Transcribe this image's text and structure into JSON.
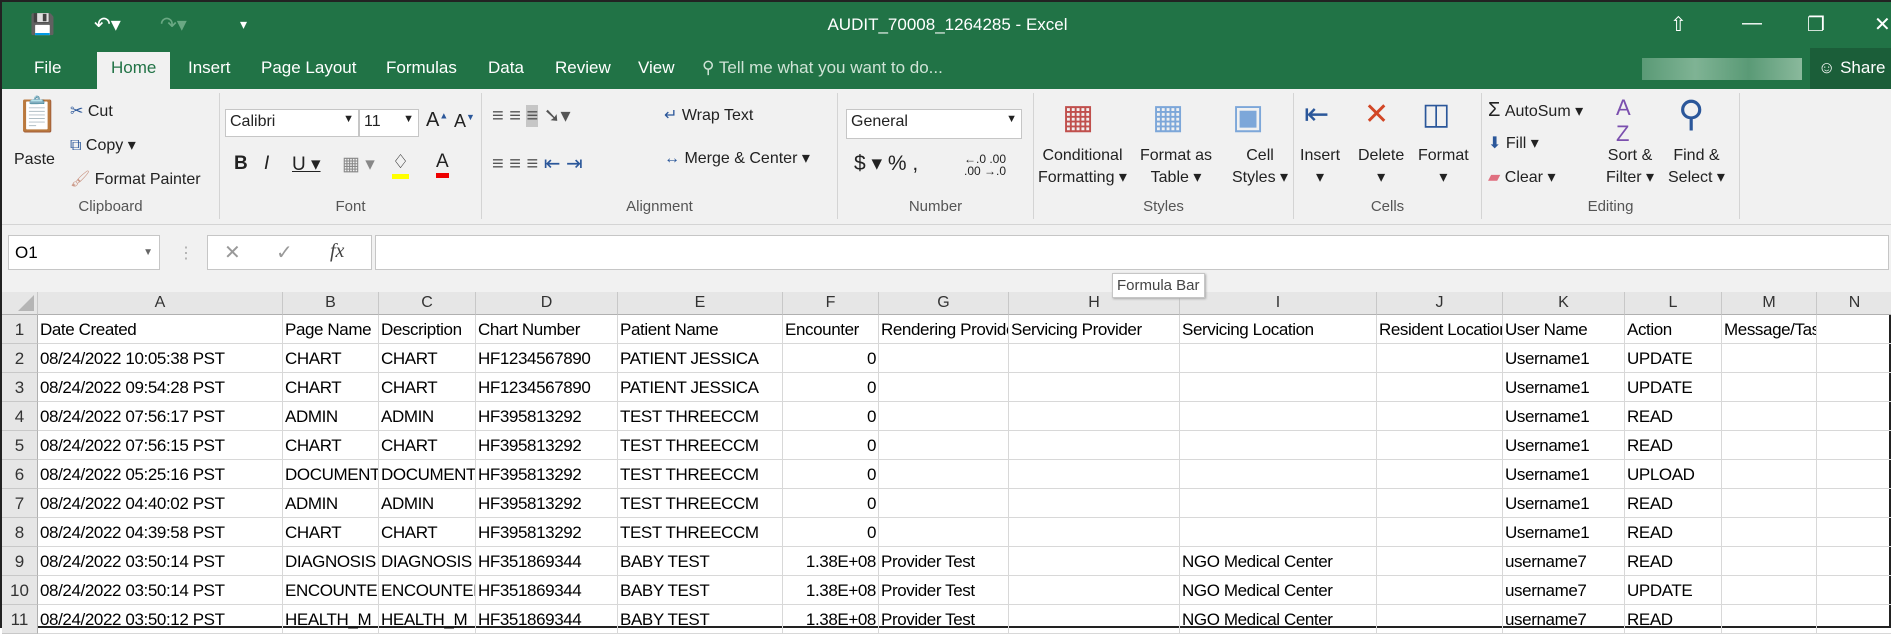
{
  "title": "AUDIT_70008_1264285 - Excel",
  "tabs": [
    "File",
    "Home",
    "Insert",
    "Page Layout",
    "Formulas",
    "Data",
    "Review",
    "View"
  ],
  "tell_me": "Tell me what you want to do...",
  "share": "Share",
  "ribbon": {
    "clipboard": {
      "label": "Clipboard",
      "paste": "Paste",
      "cut": "Cut",
      "copy": "Copy",
      "format_painter": "Format Painter"
    },
    "font": {
      "label": "Font",
      "name": "Calibri",
      "size": "11"
    },
    "alignment": {
      "label": "Alignment",
      "wrap": "Wrap Text",
      "merge": "Merge & Center"
    },
    "number": {
      "label": "Number",
      "format": "General"
    },
    "styles": {
      "label": "Styles",
      "conditional": [
        "Conditional",
        "Formatting"
      ],
      "table": [
        "Format as",
        "Table"
      ],
      "cell": [
        "Cell",
        "Styles"
      ]
    },
    "cells": {
      "label": "Cells",
      "insert": "Insert",
      "delete": "Delete",
      "format": "Format"
    },
    "editing": {
      "label": "Editing",
      "autosum": "AutoSum",
      "fill": "Fill",
      "clear": "Clear",
      "sort": [
        "Sort &",
        "Filter"
      ],
      "find": [
        "Find &",
        "Select"
      ]
    }
  },
  "name_box": "O1",
  "formula_tooltip": "Formula Bar",
  "columns": [
    "A",
    "B",
    "C",
    "D",
    "E",
    "F",
    "G",
    "H",
    "I",
    "J",
    "K",
    "L",
    "M",
    "N"
  ],
  "rows": [
    [
      "Date Created",
      "Page Name",
      "Description",
      "Chart Number",
      "Patient Name",
      "Encounter",
      "Rendering Provider",
      "Servicing Provider",
      "Servicing Location",
      "Resident Location",
      "User Name",
      "Action",
      "Message/Task ID",
      ""
    ],
    [
      "08/24/2022 10:05:38 PST",
      "CHART",
      "CHART",
      "HF1234567890",
      "PATIENT JESSICA",
      "0",
      "",
      "",
      "",
      "",
      "Username1",
      "UPDATE",
      "",
      ""
    ],
    [
      "08/24/2022 09:54:28 PST",
      "CHART",
      "CHART",
      "HF1234567890",
      "PATIENT JESSICA",
      "0",
      "",
      "",
      "",
      "",
      "Username1",
      "UPDATE",
      "",
      ""
    ],
    [
      "08/24/2022 07:56:17 PST",
      "ADMIN",
      "ADMIN",
      "HF395813292",
      "TEST THREECCM",
      "0",
      "",
      "",
      "",
      "",
      "Username1",
      "READ",
      "",
      ""
    ],
    [
      "08/24/2022 07:56:15 PST",
      "CHART",
      "CHART",
      "HF395813292",
      "TEST THREECCM",
      "0",
      "",
      "",
      "",
      "",
      "Username1",
      "READ",
      "",
      ""
    ],
    [
      "08/24/2022 05:25:16 PST",
      "DOCUMENT",
      "DOCUMENT",
      "HF395813292",
      "TEST THREECCM",
      "0",
      "",
      "",
      "",
      "",
      "Username1",
      "UPLOAD",
      "",
      ""
    ],
    [
      "08/24/2022 04:40:02 PST",
      "ADMIN",
      "ADMIN",
      "HF395813292",
      "TEST THREECCM",
      "0",
      "",
      "",
      "",
      "",
      "Username1",
      "READ",
      "",
      ""
    ],
    [
      "08/24/2022 04:39:58 PST",
      "CHART",
      "CHART",
      "HF395813292",
      "TEST THREECCM",
      "0",
      "",
      "",
      "",
      "",
      "Username1",
      "READ",
      "",
      ""
    ],
    [
      "08/24/2022 03:50:14 PST",
      "DIAGNOSIS",
      "DIAGNOSIS",
      "HF351869344",
      "BABY TEST",
      "1.38E+08",
      "Provider Test",
      "",
      "NGO Medical Center",
      "",
      "username7",
      "READ",
      "",
      ""
    ],
    [
      "08/24/2022 03:50:14 PST",
      "ENCOUNTER",
      "ENCOUNTER",
      "HF351869344",
      "BABY TEST",
      "1.38E+08",
      "Provider Test",
      "",
      "NGO Medical Center",
      "",
      "username7",
      "UPDATE",
      "",
      ""
    ],
    [
      "08/24/2022 03:50:12 PST",
      "HEALTH_M",
      "HEALTH_M",
      "HF351869344",
      "BABY TEST",
      "1.38E+08",
      "Provider Test",
      "",
      "NGO Medical Center",
      "",
      "username7",
      "READ",
      "",
      ""
    ]
  ],
  "colors": {
    "excel_green": "#217346",
    "ribbon_bg": "#f1f1f1"
  }
}
